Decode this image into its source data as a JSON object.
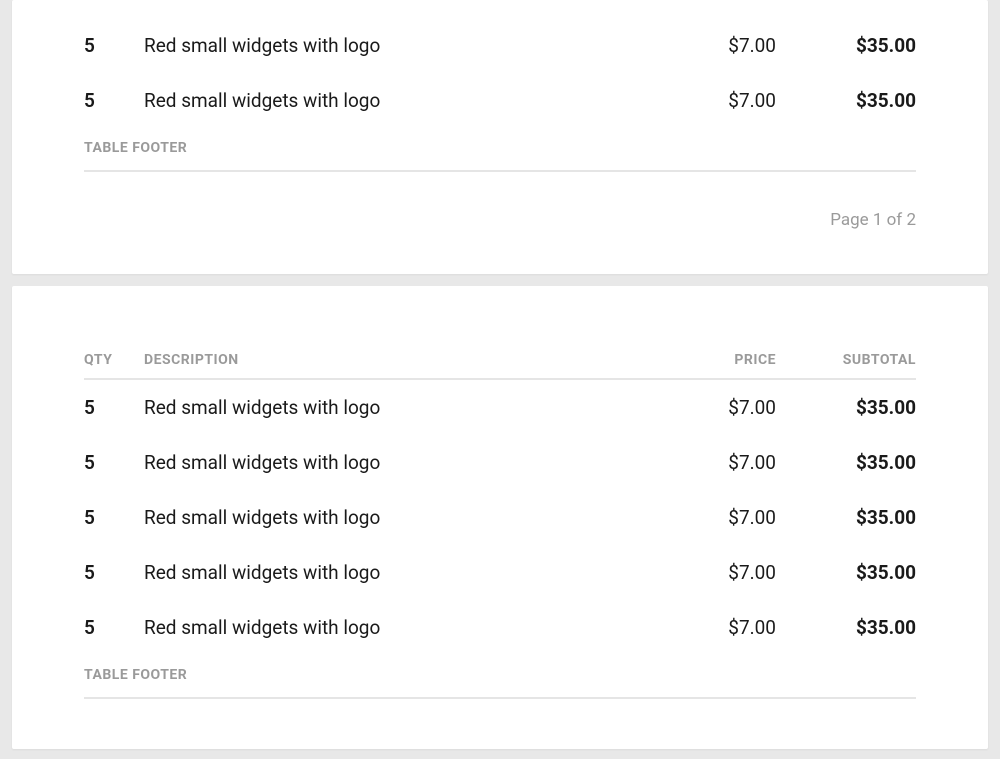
{
  "headers": {
    "qty": "QTY",
    "desc": "DESCRIPTION",
    "price": "PRICE",
    "subtotal": "SUBTOTAL"
  },
  "footer_label": "TABLE FOOTER",
  "page1": {
    "rows": [
      {
        "qty": "5",
        "desc": "Red small widgets with logo",
        "price": "$7.00",
        "subtotal": "$35.00"
      },
      {
        "qty": "5",
        "desc": "Red small widgets with logo",
        "price": "$7.00",
        "subtotal": "$35.00"
      }
    ],
    "page_text": "Page 1 of 2"
  },
  "page2": {
    "rows": [
      {
        "qty": "5",
        "desc": "Red small widgets with logo",
        "price": "$7.00",
        "subtotal": "$35.00"
      },
      {
        "qty": "5",
        "desc": "Red small widgets with logo",
        "price": "$7.00",
        "subtotal": "$35.00"
      },
      {
        "qty": "5",
        "desc": "Red small widgets with logo",
        "price": "$7.00",
        "subtotal": "$35.00"
      },
      {
        "qty": "5",
        "desc": "Red small widgets with logo",
        "price": "$7.00",
        "subtotal": "$35.00"
      },
      {
        "qty": "5",
        "desc": "Red small widgets with logo",
        "price": "$7.00",
        "subtotal": "$35.00"
      }
    ]
  }
}
